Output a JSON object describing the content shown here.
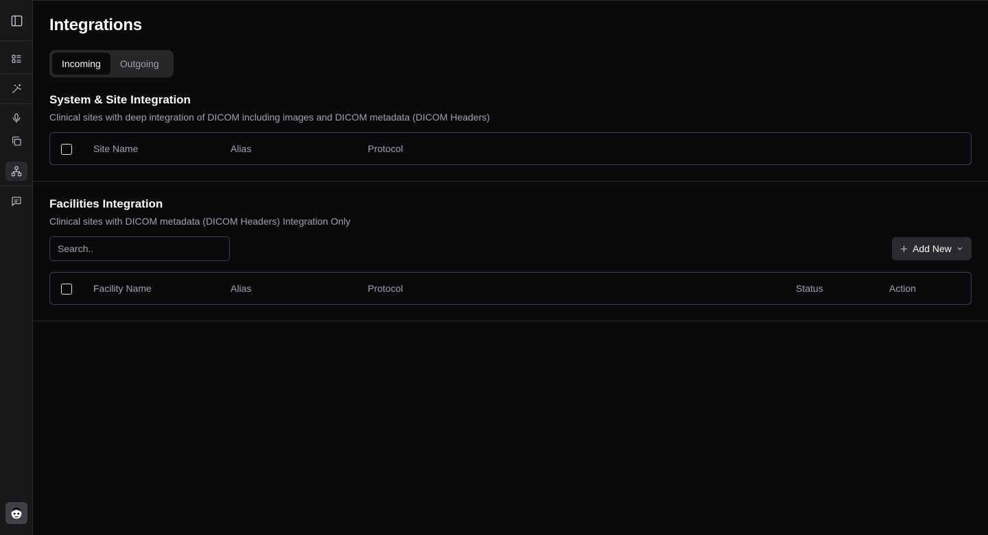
{
  "page": {
    "title": "Integrations"
  },
  "tabs": [
    {
      "label": "Incoming",
      "active": true
    },
    {
      "label": "Outgoing",
      "active": false
    }
  ],
  "sidebar": {
    "items": [
      {
        "icon": "sidebar-toggle-icon"
      },
      {
        "icon": "list-icon"
      },
      {
        "icon": "magic-wand-icon"
      },
      {
        "icon": "microphone-icon"
      },
      {
        "icon": "copy-icon"
      },
      {
        "icon": "network-icon",
        "active": true
      },
      {
        "icon": "message-icon"
      }
    ],
    "avatar": {
      "icon": "user-avatar-icon"
    }
  },
  "system_section": {
    "title": "System & Site Integration",
    "description": "Clinical sites with deep integration of DICOM including images and DICOM metadata (DICOM Headers)",
    "columns": [
      "Site Name",
      "Alias",
      "Protocol"
    ]
  },
  "facilities_section": {
    "title": "Facilities Integration",
    "description": "Clinical sites with DICOM metadata (DICOM Headers) Integration Only",
    "search": {
      "placeholder": "Search..",
      "value": ""
    },
    "add_button": {
      "label": "Add New"
    },
    "columns": [
      "Facility Name",
      "Alias",
      "Protocol",
      "Status",
      "Action"
    ]
  },
  "colors": {
    "background": "#0a0a0c",
    "sidebar": "#18181b",
    "border": "#3f3f46",
    "muted_text": "#a1a1aa"
  }
}
